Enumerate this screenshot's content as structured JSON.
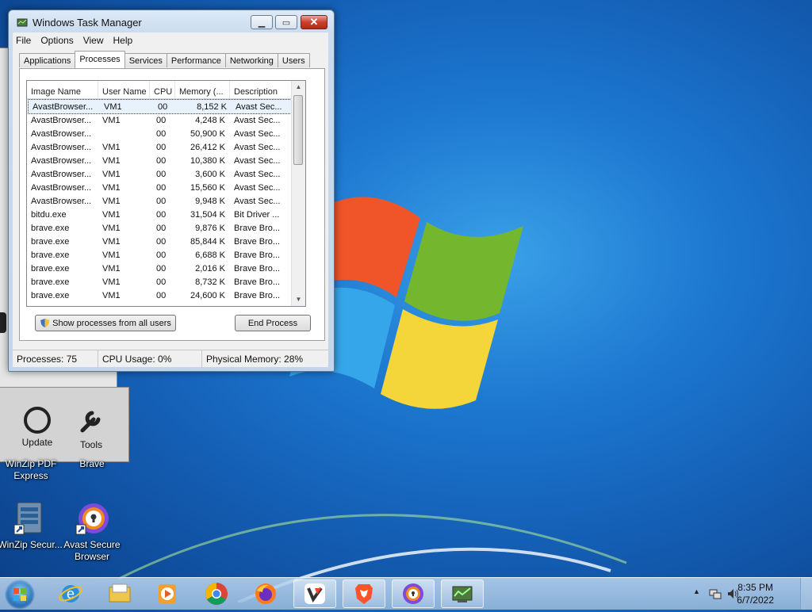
{
  "task_manager": {
    "title": "Windows Task Manager",
    "menu": [
      "File",
      "Options",
      "View",
      "Help"
    ],
    "tabs": [
      "Applications",
      "Processes",
      "Services",
      "Performance",
      "Networking",
      "Users"
    ],
    "active_tab": "Processes",
    "columns": [
      "Image Name",
      "User Name",
      "CPU",
      "Memory (...",
      "Description"
    ],
    "rows": [
      [
        "AvastBrowser...",
        "VM1",
        "00",
        "8,152 K",
        "Avast Sec..."
      ],
      [
        "AvastBrowser...",
        "VM1",
        "00",
        "4,248 K",
        "Avast Sec..."
      ],
      [
        "AvastBrowser...",
        "",
        "00",
        "50,900 K",
        "Avast Sec..."
      ],
      [
        "AvastBrowser...",
        "VM1",
        "00",
        "26,412 K",
        "Avast Sec..."
      ],
      [
        "AvastBrowser...",
        "VM1",
        "00",
        "10,380 K",
        "Avast Sec..."
      ],
      [
        "AvastBrowser...",
        "VM1",
        "00",
        "3,600 K",
        "Avast Sec..."
      ],
      [
        "AvastBrowser...",
        "VM1",
        "00",
        "15,560 K",
        "Avast Sec..."
      ],
      [
        "AvastBrowser...",
        "VM1",
        "00",
        "9,948 K",
        "Avast Sec..."
      ],
      [
        "bitdu.exe",
        "VM1",
        "00",
        "31,504 K",
        "Bit Driver ..."
      ],
      [
        "brave.exe",
        "VM1",
        "00",
        "9,876 K",
        "Brave Bro..."
      ],
      [
        "brave.exe",
        "VM1",
        "00",
        "85,844 K",
        "Brave Bro..."
      ],
      [
        "brave.exe",
        "VM1",
        "00",
        "6,688 K",
        "Brave Bro..."
      ],
      [
        "brave.exe",
        "VM1",
        "00",
        "2,016 K",
        "Brave Bro..."
      ],
      [
        "brave.exe",
        "VM1",
        "00",
        "8,732 K",
        "Brave Bro..."
      ],
      [
        "brave.exe",
        "VM1",
        "00",
        "24,600 K",
        "Brave Bro..."
      ]
    ],
    "show_all_label": "Show processes from all users",
    "end_process_label": "End Process",
    "status": {
      "processes": "Processes: 75",
      "cpu": "CPU Usage: 0%",
      "memory": "Physical Memory: 28%"
    }
  },
  "background_window": {
    "tools": [
      "Update",
      "Tools"
    ]
  },
  "desktop_icons": [
    {
      "label": "WinZip PDF Express",
      "icon": "winzip-pdf-icon"
    },
    {
      "label": "Brave",
      "icon": "brave-icon"
    },
    {
      "label": "WinZip Secur...",
      "icon": "winzip-secure-icon"
    },
    {
      "label": "Avast Secure Browser",
      "icon": "avast-browser-icon"
    }
  ],
  "taskbar": {
    "apps": [
      "internet-explorer-icon",
      "file-explorer-icon",
      "media-player-icon",
      "chrome-icon",
      "firefox-icon",
      "vivaldi-icon",
      "brave-icon",
      "avast-browser-icon",
      "task-manager-icon"
    ],
    "time": "8:35 PM",
    "date": "6/7/2022"
  }
}
